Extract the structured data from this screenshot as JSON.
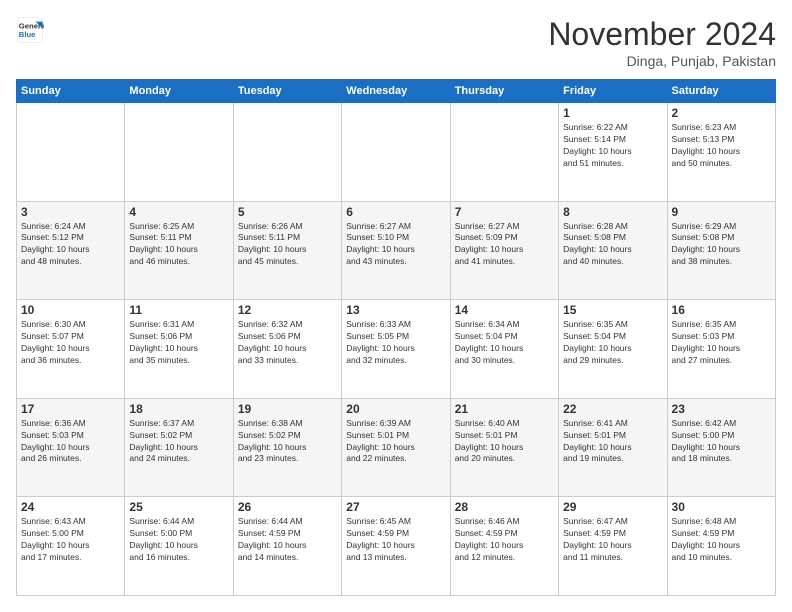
{
  "logo": {
    "line1": "General",
    "line2": "Blue"
  },
  "title": "November 2024",
  "location": "Dinga, Punjab, Pakistan",
  "weekdays": [
    "Sunday",
    "Monday",
    "Tuesday",
    "Wednesday",
    "Thursday",
    "Friday",
    "Saturday"
  ],
  "weeks": [
    [
      {
        "day": "",
        "info": ""
      },
      {
        "day": "",
        "info": ""
      },
      {
        "day": "",
        "info": ""
      },
      {
        "day": "",
        "info": ""
      },
      {
        "day": "",
        "info": ""
      },
      {
        "day": "1",
        "info": "Sunrise: 6:22 AM\nSunset: 5:14 PM\nDaylight: 10 hours\nand 51 minutes."
      },
      {
        "day": "2",
        "info": "Sunrise: 6:23 AM\nSunset: 5:13 PM\nDaylight: 10 hours\nand 50 minutes."
      }
    ],
    [
      {
        "day": "3",
        "info": "Sunrise: 6:24 AM\nSunset: 5:12 PM\nDaylight: 10 hours\nand 48 minutes."
      },
      {
        "day": "4",
        "info": "Sunrise: 6:25 AM\nSunset: 5:11 PM\nDaylight: 10 hours\nand 46 minutes."
      },
      {
        "day": "5",
        "info": "Sunrise: 6:26 AM\nSunset: 5:11 PM\nDaylight: 10 hours\nand 45 minutes."
      },
      {
        "day": "6",
        "info": "Sunrise: 6:27 AM\nSunset: 5:10 PM\nDaylight: 10 hours\nand 43 minutes."
      },
      {
        "day": "7",
        "info": "Sunrise: 6:27 AM\nSunset: 5:09 PM\nDaylight: 10 hours\nand 41 minutes."
      },
      {
        "day": "8",
        "info": "Sunrise: 6:28 AM\nSunset: 5:08 PM\nDaylight: 10 hours\nand 40 minutes."
      },
      {
        "day": "9",
        "info": "Sunrise: 6:29 AM\nSunset: 5:08 PM\nDaylight: 10 hours\nand 38 minutes."
      }
    ],
    [
      {
        "day": "10",
        "info": "Sunrise: 6:30 AM\nSunset: 5:07 PM\nDaylight: 10 hours\nand 36 minutes."
      },
      {
        "day": "11",
        "info": "Sunrise: 6:31 AM\nSunset: 5:06 PM\nDaylight: 10 hours\nand 35 minutes."
      },
      {
        "day": "12",
        "info": "Sunrise: 6:32 AM\nSunset: 5:06 PM\nDaylight: 10 hours\nand 33 minutes."
      },
      {
        "day": "13",
        "info": "Sunrise: 6:33 AM\nSunset: 5:05 PM\nDaylight: 10 hours\nand 32 minutes."
      },
      {
        "day": "14",
        "info": "Sunrise: 6:34 AM\nSunset: 5:04 PM\nDaylight: 10 hours\nand 30 minutes."
      },
      {
        "day": "15",
        "info": "Sunrise: 6:35 AM\nSunset: 5:04 PM\nDaylight: 10 hours\nand 29 minutes."
      },
      {
        "day": "16",
        "info": "Sunrise: 6:35 AM\nSunset: 5:03 PM\nDaylight: 10 hours\nand 27 minutes."
      }
    ],
    [
      {
        "day": "17",
        "info": "Sunrise: 6:36 AM\nSunset: 5:03 PM\nDaylight: 10 hours\nand 26 minutes."
      },
      {
        "day": "18",
        "info": "Sunrise: 6:37 AM\nSunset: 5:02 PM\nDaylight: 10 hours\nand 24 minutes."
      },
      {
        "day": "19",
        "info": "Sunrise: 6:38 AM\nSunset: 5:02 PM\nDaylight: 10 hours\nand 23 minutes."
      },
      {
        "day": "20",
        "info": "Sunrise: 6:39 AM\nSunset: 5:01 PM\nDaylight: 10 hours\nand 22 minutes."
      },
      {
        "day": "21",
        "info": "Sunrise: 6:40 AM\nSunset: 5:01 PM\nDaylight: 10 hours\nand 20 minutes."
      },
      {
        "day": "22",
        "info": "Sunrise: 6:41 AM\nSunset: 5:01 PM\nDaylight: 10 hours\nand 19 minutes."
      },
      {
        "day": "23",
        "info": "Sunrise: 6:42 AM\nSunset: 5:00 PM\nDaylight: 10 hours\nand 18 minutes."
      }
    ],
    [
      {
        "day": "24",
        "info": "Sunrise: 6:43 AM\nSunset: 5:00 PM\nDaylight: 10 hours\nand 17 minutes."
      },
      {
        "day": "25",
        "info": "Sunrise: 6:44 AM\nSunset: 5:00 PM\nDaylight: 10 hours\nand 16 minutes."
      },
      {
        "day": "26",
        "info": "Sunrise: 6:44 AM\nSunset: 4:59 PM\nDaylight: 10 hours\nand 14 minutes."
      },
      {
        "day": "27",
        "info": "Sunrise: 6:45 AM\nSunset: 4:59 PM\nDaylight: 10 hours\nand 13 minutes."
      },
      {
        "day": "28",
        "info": "Sunrise: 6:46 AM\nSunset: 4:59 PM\nDaylight: 10 hours\nand 12 minutes."
      },
      {
        "day": "29",
        "info": "Sunrise: 6:47 AM\nSunset: 4:59 PM\nDaylight: 10 hours\nand 11 minutes."
      },
      {
        "day": "30",
        "info": "Sunrise: 6:48 AM\nSunset: 4:59 PM\nDaylight: 10 hours\nand 10 minutes."
      }
    ]
  ]
}
